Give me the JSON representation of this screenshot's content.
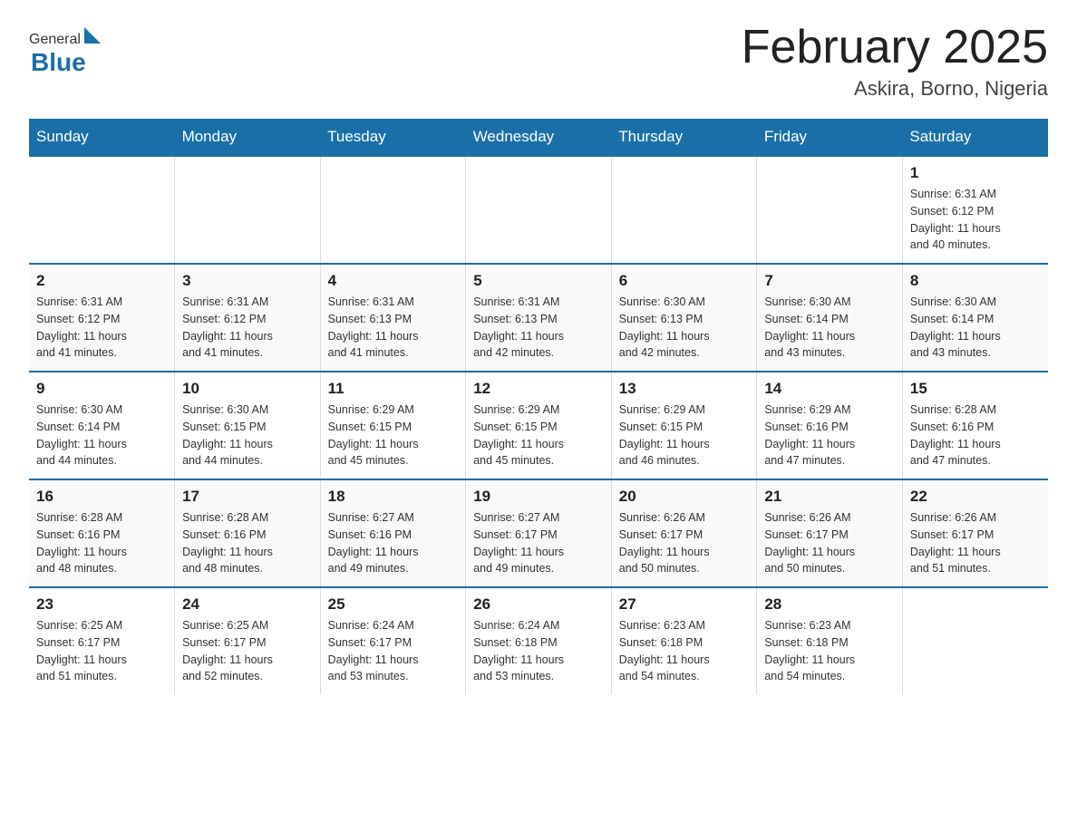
{
  "header": {
    "logo_general": "General",
    "logo_blue": "Blue",
    "title": "February 2025",
    "location": "Askira, Borno, Nigeria"
  },
  "days_of_week": [
    "Sunday",
    "Monday",
    "Tuesday",
    "Wednesday",
    "Thursday",
    "Friday",
    "Saturday"
  ],
  "weeks": [
    [
      {
        "day": "",
        "info": ""
      },
      {
        "day": "",
        "info": ""
      },
      {
        "day": "",
        "info": ""
      },
      {
        "day": "",
        "info": ""
      },
      {
        "day": "",
        "info": ""
      },
      {
        "day": "",
        "info": ""
      },
      {
        "day": "1",
        "info": "Sunrise: 6:31 AM\nSunset: 6:12 PM\nDaylight: 11 hours\nand 40 minutes."
      }
    ],
    [
      {
        "day": "2",
        "info": "Sunrise: 6:31 AM\nSunset: 6:12 PM\nDaylight: 11 hours\nand 41 minutes."
      },
      {
        "day": "3",
        "info": "Sunrise: 6:31 AM\nSunset: 6:12 PM\nDaylight: 11 hours\nand 41 minutes."
      },
      {
        "day": "4",
        "info": "Sunrise: 6:31 AM\nSunset: 6:13 PM\nDaylight: 11 hours\nand 41 minutes."
      },
      {
        "day": "5",
        "info": "Sunrise: 6:31 AM\nSunset: 6:13 PM\nDaylight: 11 hours\nand 42 minutes."
      },
      {
        "day": "6",
        "info": "Sunrise: 6:30 AM\nSunset: 6:13 PM\nDaylight: 11 hours\nand 42 minutes."
      },
      {
        "day": "7",
        "info": "Sunrise: 6:30 AM\nSunset: 6:14 PM\nDaylight: 11 hours\nand 43 minutes."
      },
      {
        "day": "8",
        "info": "Sunrise: 6:30 AM\nSunset: 6:14 PM\nDaylight: 11 hours\nand 43 minutes."
      }
    ],
    [
      {
        "day": "9",
        "info": "Sunrise: 6:30 AM\nSunset: 6:14 PM\nDaylight: 11 hours\nand 44 minutes."
      },
      {
        "day": "10",
        "info": "Sunrise: 6:30 AM\nSunset: 6:15 PM\nDaylight: 11 hours\nand 44 minutes."
      },
      {
        "day": "11",
        "info": "Sunrise: 6:29 AM\nSunset: 6:15 PM\nDaylight: 11 hours\nand 45 minutes."
      },
      {
        "day": "12",
        "info": "Sunrise: 6:29 AM\nSunset: 6:15 PM\nDaylight: 11 hours\nand 45 minutes."
      },
      {
        "day": "13",
        "info": "Sunrise: 6:29 AM\nSunset: 6:15 PM\nDaylight: 11 hours\nand 46 minutes."
      },
      {
        "day": "14",
        "info": "Sunrise: 6:29 AM\nSunset: 6:16 PM\nDaylight: 11 hours\nand 47 minutes."
      },
      {
        "day": "15",
        "info": "Sunrise: 6:28 AM\nSunset: 6:16 PM\nDaylight: 11 hours\nand 47 minutes."
      }
    ],
    [
      {
        "day": "16",
        "info": "Sunrise: 6:28 AM\nSunset: 6:16 PM\nDaylight: 11 hours\nand 48 minutes."
      },
      {
        "day": "17",
        "info": "Sunrise: 6:28 AM\nSunset: 6:16 PM\nDaylight: 11 hours\nand 48 minutes."
      },
      {
        "day": "18",
        "info": "Sunrise: 6:27 AM\nSunset: 6:16 PM\nDaylight: 11 hours\nand 49 minutes."
      },
      {
        "day": "19",
        "info": "Sunrise: 6:27 AM\nSunset: 6:17 PM\nDaylight: 11 hours\nand 49 minutes."
      },
      {
        "day": "20",
        "info": "Sunrise: 6:26 AM\nSunset: 6:17 PM\nDaylight: 11 hours\nand 50 minutes."
      },
      {
        "day": "21",
        "info": "Sunrise: 6:26 AM\nSunset: 6:17 PM\nDaylight: 11 hours\nand 50 minutes."
      },
      {
        "day": "22",
        "info": "Sunrise: 6:26 AM\nSunset: 6:17 PM\nDaylight: 11 hours\nand 51 minutes."
      }
    ],
    [
      {
        "day": "23",
        "info": "Sunrise: 6:25 AM\nSunset: 6:17 PM\nDaylight: 11 hours\nand 51 minutes."
      },
      {
        "day": "24",
        "info": "Sunrise: 6:25 AM\nSunset: 6:17 PM\nDaylight: 11 hours\nand 52 minutes."
      },
      {
        "day": "25",
        "info": "Sunrise: 6:24 AM\nSunset: 6:17 PM\nDaylight: 11 hours\nand 53 minutes."
      },
      {
        "day": "26",
        "info": "Sunrise: 6:24 AM\nSunset: 6:18 PM\nDaylight: 11 hours\nand 53 minutes."
      },
      {
        "day": "27",
        "info": "Sunrise: 6:23 AM\nSunset: 6:18 PM\nDaylight: 11 hours\nand 54 minutes."
      },
      {
        "day": "28",
        "info": "Sunrise: 6:23 AM\nSunset: 6:18 PM\nDaylight: 11 hours\nand 54 minutes."
      },
      {
        "day": "",
        "info": ""
      }
    ]
  ]
}
